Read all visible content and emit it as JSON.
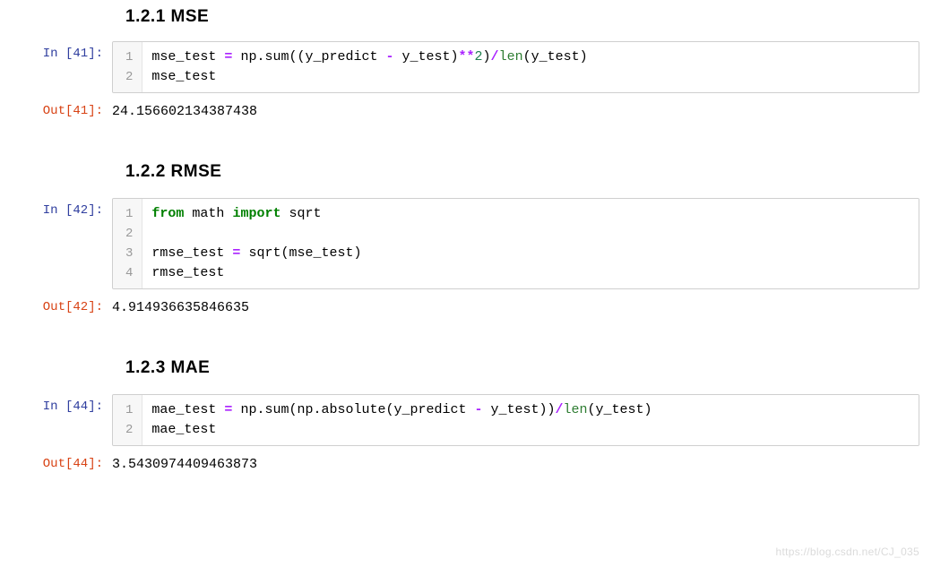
{
  "headings": {
    "mse": "1.2.1  MSE",
    "rmse": "1.2.2  RMSE",
    "mae": "1.2.3  MAE"
  },
  "cells": {
    "mse": {
      "in_prompt": "In [41]:",
      "out_prompt": "Out[41]:",
      "gutter": [
        "1",
        "2"
      ],
      "code": {
        "l1_a": "mse_test ",
        "l1_eq": "=",
        "l1_b": " np.sum((y_predict ",
        "l1_minus": "-",
        "l1_c": " y_test)",
        "l1_pow": "**",
        "l1_two": "2",
        "l1_d": ")",
        "l1_slash": "/",
        "l1_len": "len",
        "l1_e": "(y_test)",
        "l2": "mse_test"
      },
      "output": "24.156602134387438"
    },
    "rmse": {
      "in_prompt": "In [42]:",
      "out_prompt": "Out[42]:",
      "gutter": [
        "1",
        "2",
        "3",
        "4"
      ],
      "code": {
        "l1_from": "from",
        "l1_sp1": " math ",
        "l1_import": "import",
        "l1_sp2": " sqrt",
        "l2": "",
        "l3_a": "rmse_test ",
        "l3_eq": "=",
        "l3_b": " sqrt(mse_test)",
        "l4": "rmse_test"
      },
      "output": "4.914936635846635"
    },
    "mae": {
      "in_prompt": "In [44]:",
      "out_prompt": "Out[44]:",
      "gutter": [
        "1",
        "2"
      ],
      "code": {
        "l1_a": "mae_test ",
        "l1_eq": "=",
        "l1_b": " np.sum(np.absolute(y_predict ",
        "l1_minus": "-",
        "l1_c": " y_test))",
        "l1_slash": "/",
        "l1_len": "len",
        "l1_d": "(y_test)",
        "l2": "mae_test"
      },
      "output": "3.5430974409463873"
    }
  },
  "watermark": "https://blog.csdn.net/CJ_035"
}
